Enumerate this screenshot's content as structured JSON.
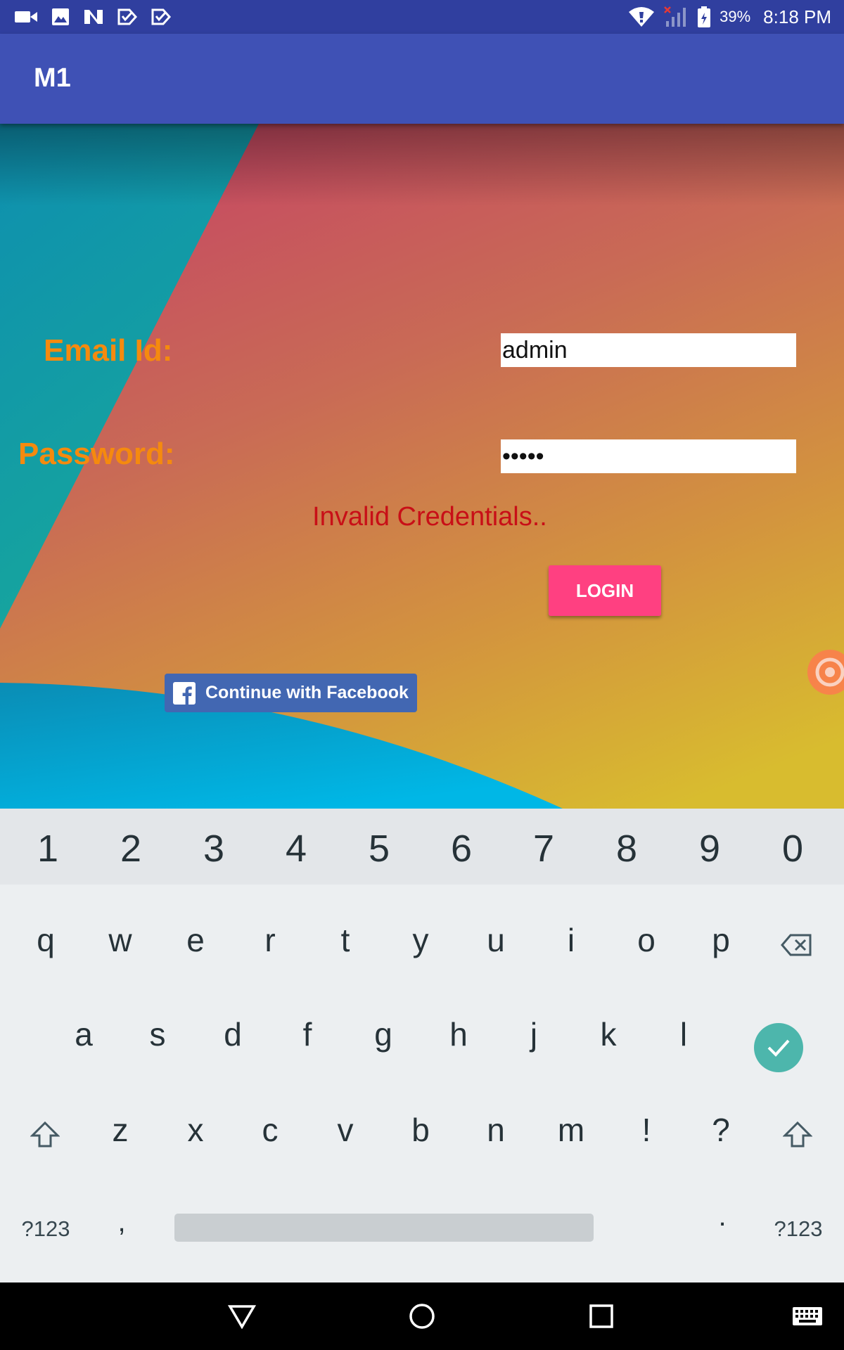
{
  "status_bar": {
    "battery_percent": "39%",
    "time": "8:18 PM",
    "left_icons": [
      "video-icon",
      "image-icon",
      "n-icon",
      "checkmark-flag-icon",
      "checkmark-flag-icon"
    ],
    "right_icons": [
      "wifi-icon",
      "signal-icon",
      "battery-icon"
    ]
  },
  "app_bar": {
    "title": "M1"
  },
  "form": {
    "email_label": "Email Id:",
    "email_value": "admin",
    "password_label": "Password:",
    "password_value": "•••••",
    "error_message": "Invalid Credentials..",
    "login_label": "LOGIN",
    "facebook_label": "Continue with Facebook"
  },
  "keyboard": {
    "numbers": [
      "1",
      "2",
      "3",
      "4",
      "5",
      "6",
      "7",
      "8",
      "9",
      "0"
    ],
    "row1": [
      "q",
      "w",
      "e",
      "r",
      "t",
      "y",
      "u",
      "i",
      "o",
      "p"
    ],
    "row2": [
      "a",
      "s",
      "d",
      "f",
      "g",
      "h",
      "j",
      "k",
      "l"
    ],
    "row3": [
      "z",
      "x",
      "c",
      "v",
      "b",
      "n",
      "m",
      "!",
      "?"
    ],
    "symbols_label": "?123",
    "comma": ",",
    "period": "."
  },
  "colors": {
    "status_bar": "#303F9F",
    "app_bar": "#3F51B5",
    "label": "#F58A0E",
    "error": "#C80F17",
    "login_button": "#FF4081",
    "facebook": "#4267B2",
    "keyboard_bg": "#ECEFF1",
    "enter_key": "#4DB6AC"
  }
}
